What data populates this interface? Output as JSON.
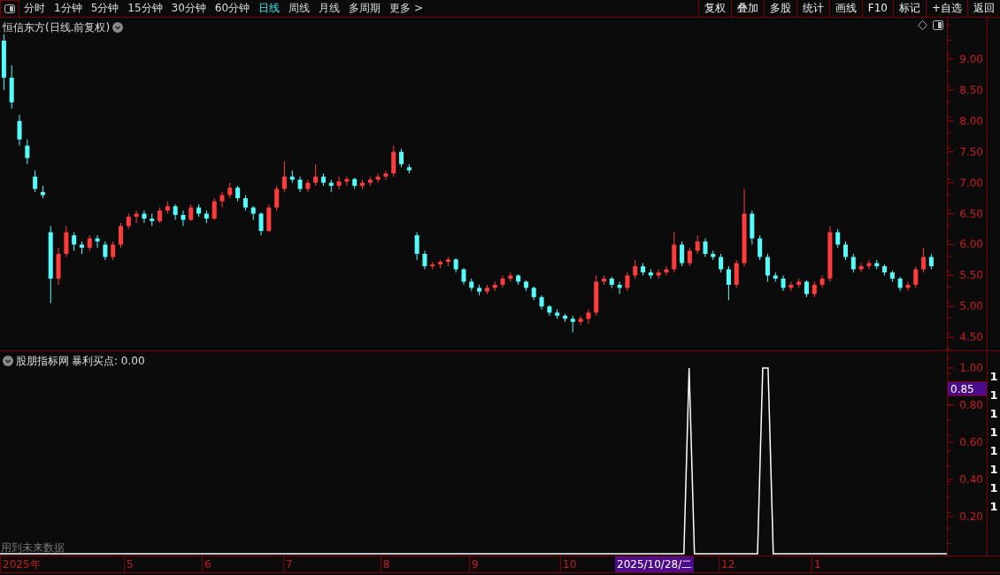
{
  "toolbar": {
    "periods": [
      {
        "label": "分时",
        "selected": false
      },
      {
        "label": "1分钟",
        "selected": false
      },
      {
        "label": "5分钟",
        "selected": false
      },
      {
        "label": "15分钟",
        "selected": false
      },
      {
        "label": "30分钟",
        "selected": false
      },
      {
        "label": "60分钟",
        "selected": false
      },
      {
        "label": "日线",
        "selected": true
      },
      {
        "label": "周线",
        "selected": false
      },
      {
        "label": "月线",
        "selected": false
      },
      {
        "label": "多周期",
        "selected": false
      },
      {
        "label": "更多 >",
        "selected": false
      }
    ],
    "buttons": [
      "复权",
      "叠加",
      "多股",
      "统计",
      "画线",
      "F10",
      "标记",
      "+自选",
      "返回"
    ]
  },
  "price_chart": {
    "chart_data": {
      "type": "candlestick",
      "title": "恒信东方(日线.前复权)",
      "ylim": [
        4.29,
        9.67
      ],
      "yticks": [
        {
          "value": 9,
          "label": "9.00"
        },
        {
          "value": 8.5,
          "label": "8.50"
        },
        {
          "value": 8,
          "label": "8.00"
        },
        {
          "value": 7.5,
          "label": "7.50"
        },
        {
          "value": 7,
          "label": "7.00"
        },
        {
          "value": 6.5,
          "label": "6.50"
        },
        {
          "value": 6,
          "label": "6.00"
        },
        {
          "value": 5.5,
          "label": "5.50"
        },
        {
          "value": 5,
          "label": "5.00"
        },
        {
          "value": 4.5,
          "label": "4.50"
        }
      ],
      "categories": [
        null,
        null,
        null,
        null,
        null,
        null,
        null,
        null,
        null,
        null,
        null,
        null,
        null,
        null,
        null,
        null,
        null,
        null,
        null,
        null,
        null,
        null,
        null,
        null,
        null,
        null,
        null,
        null,
        null,
        null,
        null,
        null,
        null,
        null,
        null,
        null,
        null,
        null,
        null,
        null,
        null,
        null,
        null,
        null,
        null,
        null,
        null,
        null,
        null,
        null,
        null,
        null,
        null,
        null,
        null,
        null,
        null,
        null,
        null,
        null,
        null,
        null,
        null,
        null,
        null,
        null,
        null,
        null,
        null,
        null,
        null,
        null,
        null,
        null,
        null,
        null,
        null,
        null,
        null,
        null,
        null,
        null,
        null,
        null,
        null,
        null,
        null,
        null,
        null,
        null,
        null,
        null,
        null,
        null,
        null,
        null,
        null,
        null,
        null,
        null,
        null,
        null,
        null,
        null,
        null,
        null,
        null,
        null,
        null,
        null,
        null,
        null,
        null,
        null,
        null,
        null,
        null,
        null,
        null,
        null
      ],
      "ohlc": [
        [
          9.3,
          9.4,
          8.5,
          8.7
        ],
        [
          8.7,
          8.9,
          8.2,
          8.3
        ],
        [
          8.0,
          8.1,
          7.6,
          7.7
        ],
        [
          7.6,
          7.7,
          7.3,
          7.4
        ],
        [
          7.1,
          7.2,
          6.85,
          6.9
        ],
        [
          6.85,
          6.95,
          6.75,
          6.8
        ],
        [
          6.2,
          6.3,
          5.05,
          5.45
        ],
        [
          5.45,
          5.95,
          5.35,
          5.85
        ],
        [
          5.85,
          6.3,
          5.8,
          6.2
        ],
        [
          6.15,
          6.2,
          5.9,
          6.0
        ],
        [
          6.0,
          6.05,
          5.85,
          5.95
        ],
        [
          5.95,
          6.15,
          5.9,
          6.1
        ],
        [
          6.1,
          6.15,
          5.95,
          6.05
        ],
        [
          6.0,
          6.05,
          5.75,
          5.8
        ],
        [
          5.8,
          6.05,
          5.75,
          6.0
        ],
        [
          6.0,
          6.35,
          5.95,
          6.3
        ],
        [
          6.3,
          6.5,
          6.25,
          6.45
        ],
        [
          6.45,
          6.55,
          6.35,
          6.5
        ],
        [
          6.5,
          6.55,
          6.35,
          6.42
        ],
        [
          6.42,
          6.5,
          6.3,
          6.38
        ],
        [
          6.38,
          6.6,
          6.35,
          6.55
        ],
        [
          6.55,
          6.7,
          6.5,
          6.62
        ],
        [
          6.62,
          6.65,
          6.4,
          6.48
        ],
        [
          6.48,
          6.55,
          6.3,
          6.4
        ],
        [
          6.4,
          6.65,
          6.38,
          6.6
        ],
        [
          6.6,
          6.65,
          6.45,
          6.5
        ],
        [
          6.5,
          6.55,
          6.35,
          6.42
        ],
        [
          6.42,
          6.75,
          6.4,
          6.7
        ],
        [
          6.7,
          6.85,
          6.6,
          6.8
        ],
        [
          6.8,
          7.0,
          6.75,
          6.92
        ],
        [
          6.92,
          6.95,
          6.7,
          6.75
        ],
        [
          6.75,
          6.8,
          6.55,
          6.6
        ],
        [
          6.6,
          6.62,
          6.4,
          6.5
        ],
        [
          6.5,
          6.52,
          6.15,
          6.22
        ],
        [
          6.22,
          6.65,
          6.2,
          6.6
        ],
        [
          6.6,
          6.95,
          6.55,
          6.9
        ],
        [
          6.9,
          7.35,
          6.85,
          7.1
        ],
        [
          7.1,
          7.2,
          7.0,
          7.05
        ],
        [
          7.05,
          7.1,
          6.85,
          6.9
        ],
        [
          6.9,
          7.05,
          6.85,
          7.0
        ],
        [
          7.0,
          7.3,
          6.95,
          7.1
        ],
        [
          7.1,
          7.15,
          6.95,
          7.0
        ],
        [
          7.0,
          7.05,
          6.85,
          6.95
        ],
        [
          6.95,
          7.1,
          6.9,
          7.02
        ],
        [
          7.02,
          7.1,
          6.95,
          7.06
        ],
        [
          7.06,
          7.08,
          6.9,
          6.95
        ],
        [
          6.95,
          7.05,
          6.9,
          7.0
        ],
        [
          7.0,
          7.1,
          6.95,
          7.05
        ],
        [
          7.05,
          7.15,
          7.0,
          7.1
        ],
        [
          7.1,
          7.2,
          7.05,
          7.15
        ],
        [
          7.15,
          7.6,
          7.1,
          7.5
        ],
        [
          7.5,
          7.55,
          7.25,
          7.3
        ],
        [
          7.25,
          7.3,
          7.15,
          7.2
        ],
        [
          6.15,
          6.2,
          5.75,
          5.85
        ],
        [
          5.85,
          5.9,
          5.6,
          5.65
        ],
        [
          5.65,
          5.72,
          5.6,
          5.68
        ],
        [
          5.68,
          5.75,
          5.62,
          5.72
        ],
        [
          5.72,
          5.8,
          5.65,
          5.76
        ],
        [
          5.76,
          5.78,
          5.55,
          5.6
        ],
        [
          5.6,
          5.62,
          5.35,
          5.4
        ],
        [
          5.4,
          5.45,
          5.25,
          5.3
        ],
        [
          5.3,
          5.35,
          5.18,
          5.24
        ],
        [
          5.24,
          5.35,
          5.2,
          5.3
        ],
        [
          5.3,
          5.4,
          5.25,
          5.35
        ],
        [
          5.35,
          5.5,
          5.3,
          5.45
        ],
        [
          5.45,
          5.55,
          5.4,
          5.5
        ],
        [
          5.5,
          5.52,
          5.35,
          5.4
        ],
        [
          5.4,
          5.42,
          5.25,
          5.3
        ],
        [
          5.3,
          5.32,
          5.1,
          5.15
        ],
        [
          5.15,
          5.18,
          4.95,
          5.0
        ],
        [
          5.0,
          5.02,
          4.85,
          4.9
        ],
        [
          4.9,
          4.95,
          4.8,
          4.85
        ],
        [
          4.85,
          4.88,
          4.75,
          4.8
        ],
        [
          4.8,
          4.85,
          4.58,
          4.75
        ],
        [
          4.75,
          4.85,
          4.7,
          4.8
        ],
        [
          4.8,
          4.95,
          4.72,
          4.9
        ],
        [
          4.9,
          5.5,
          4.85,
          5.4
        ],
        [
          5.4,
          5.5,
          5.35,
          5.45
        ],
        [
          5.45,
          5.48,
          5.3,
          5.35
        ],
        [
          5.35,
          5.4,
          5.2,
          5.3
        ],
        [
          5.3,
          5.55,
          5.25,
          5.5
        ],
        [
          5.5,
          5.75,
          5.45,
          5.65
        ],
        [
          5.65,
          5.7,
          5.5,
          5.55
        ],
        [
          5.55,
          5.6,
          5.45,
          5.5
        ],
        [
          5.5,
          5.6,
          5.45,
          5.55
        ],
        [
          5.55,
          5.65,
          5.5,
          5.6
        ],
        [
          5.6,
          6.2,
          5.55,
          6.0
        ],
        [
          6.0,
          6.05,
          5.65,
          5.7
        ],
        [
          5.7,
          5.95,
          5.65,
          5.9
        ],
        [
          5.9,
          6.15,
          5.85,
          6.05
        ],
        [
          6.05,
          6.1,
          5.8,
          5.85
        ],
        [
          5.85,
          5.9,
          5.75,
          5.8
        ],
        [
          5.8,
          5.85,
          5.55,
          5.6
        ],
        [
          5.6,
          5.65,
          5.1,
          5.35
        ],
        [
          5.35,
          5.75,
          5.3,
          5.7
        ],
        [
          5.7,
          6.9,
          5.65,
          6.5
        ],
        [
          6.5,
          6.55,
          6.0,
          6.1
        ],
        [
          6.1,
          6.15,
          5.75,
          5.8
        ],
        [
          5.8,
          5.85,
          5.4,
          5.5
        ],
        [
          5.5,
          5.55,
          5.4,
          5.45
        ],
        [
          5.45,
          5.5,
          5.25,
          5.3
        ],
        [
          5.3,
          5.4,
          5.25,
          5.35
        ],
        [
          5.35,
          5.45,
          5.3,
          5.4
        ],
        [
          5.4,
          5.42,
          5.15,
          5.2
        ],
        [
          5.2,
          5.4,
          5.15,
          5.35
        ],
        [
          5.35,
          5.5,
          5.3,
          5.45
        ],
        [
          5.45,
          6.3,
          5.4,
          6.2
        ],
        [
          6.2,
          6.25,
          5.95,
          6.0
        ],
        [
          6.0,
          6.05,
          5.75,
          5.8
        ],
        [
          5.8,
          5.85,
          5.55,
          5.6
        ],
        [
          5.6,
          5.7,
          5.55,
          5.65
        ],
        [
          5.65,
          5.75,
          5.6,
          5.7
        ],
        [
          5.7,
          5.75,
          5.6,
          5.65
        ],
        [
          5.65,
          5.68,
          5.5,
          5.55
        ],
        [
          5.55,
          5.58,
          5.4,
          5.45
        ],
        [
          5.45,
          5.48,
          5.25,
          5.3
        ],
        [
          5.3,
          5.4,
          5.25,
          5.35
        ],
        [
          5.35,
          5.65,
          5.3,
          5.6
        ],
        [
          5.6,
          5.95,
          5.55,
          5.8
        ],
        [
          5.8,
          5.85,
          5.6,
          5.65
        ]
      ]
    }
  },
  "indicator": {
    "title": "股朋指标网",
    "readout": ": 0.00",
    "cursor_value": "0.85",
    "note": "用到未来数据",
    "chart_data": {
      "type": "line",
      "ylim": [
        0,
        1.09
      ],
      "categories": [
        null,
        null,
        null,
        null,
        null,
        null,
        null,
        null,
        null,
        null,
        null,
        null,
        null,
        null,
        null,
        null,
        null,
        null,
        null,
        null,
        null,
        null,
        null,
        null,
        null,
        null,
        null,
        null,
        null,
        null,
        null,
        null,
        null,
        null,
        null,
        null,
        null,
        null,
        null,
        null,
        null,
        null,
        null,
        null,
        null,
        null,
        null,
        null,
        null,
        null,
        null,
        null,
        null,
        null,
        null,
        null,
        null,
        null,
        null,
        null,
        null,
        null,
        null,
        null,
        null,
        null,
        null,
        null,
        null,
        null,
        null,
        null,
        null,
        null,
        null,
        null,
        null,
        null,
        null,
        null,
        null,
        null,
        null,
        null,
        null,
        null,
        null,
        null,
        null,
        null,
        null,
        null,
        null,
        null,
        null,
        null,
        null,
        null,
        null,
        null,
        null,
        null,
        null,
        null,
        null,
        null,
        null,
        null,
        null,
        null,
        null,
        null,
        null,
        null,
        null,
        null,
        null,
        null,
        null,
        null,
        null,
        null,
        null,
        null,
        null,
        null,
        null,
        null,
        null,
        null,
        null,
        null,
        null,
        null,
        null,
        null,
        null,
        null,
        null,
        null,
        null,
        null,
        null,
        null,
        null,
        null,
        null,
        null,
        null,
        null,
        null,
        null,
        null,
        null,
        null,
        null,
        null,
        null,
        null,
        null,
        null,
        null,
        null,
        null,
        null,
        null,
        null,
        null,
        null,
        null,
        null,
        null,
        null,
        null,
        null,
        null,
        null,
        null,
        null,
        null,
        null
      ],
      "yticks": [
        {
          "value": 1,
          "label": "1.00"
        },
        {
          "value": 0.8,
          "label": "0.80"
        },
        {
          "value": 0.6,
          "label": "0.60"
        },
        {
          "value": 0.4,
          "label": "0.40"
        },
        {
          "value": 0.2,
          "label": "0.20"
        }
      ],
      "series": [
        {
          "name": "暴利买点",
          "color": "#ffffff",
          "values": [
            0,
            0,
            0,
            0,
            0,
            0,
            0,
            0,
            0,
            0,
            0,
            0,
            0,
            0,
            0,
            0,
            0,
            0,
            0,
            0,
            0,
            0,
            0,
            0,
            0,
            0,
            0,
            0,
            0,
            0,
            0,
            0,
            0,
            0,
            0,
            0,
            0,
            0,
            0,
            0,
            0,
            0,
            0,
            0,
            0,
            0,
            0,
            0,
            0,
            0,
            0,
            0,
            0,
            0,
            0,
            0,
            0,
            0,
            0,
            0,
            0,
            0,
            0,
            0,
            0,
            0,
            0,
            0,
            0,
            0,
            0,
            0,
            0,
            0,
            0,
            0,
            0,
            0,
            0,
            0,
            0,
            0,
            0,
            0,
            0,
            0,
            0,
            0,
            0,
            0,
            0,
            0,
            0,
            0,
            0,
            0,
            0,
            0,
            0,
            0,
            0,
            0,
            0,
            0,
            0,
            0,
            0,
            0,
            0,
            0,
            0,
            0,
            0,
            0,
            0,
            0,
            0,
            0,
            0,
            0,
            0,
            0,
            0,
            0,
            0,
            0,
            0,
            0,
            0,
            0,
            0,
            1,
            0,
            0,
            0,
            0,
            0,
            0,
            0,
            0,
            0,
            0,
            0,
            0,
            0,
            1,
            1,
            0,
            0,
            0,
            0,
            0,
            0,
            0,
            0,
            0,
            0,
            0,
            0,
            0,
            0,
            0,
            0,
            0,
            0,
            0,
            0,
            0,
            0,
            0,
            0,
            0,
            0,
            0,
            0,
            0,
            0,
            0,
            0,
            0,
            0
          ]
        }
      ]
    }
  },
  "side_strip": {
    "digits": [
      "1",
      "1",
      "1",
      "1",
      "1",
      "1",
      "1",
      "1"
    ]
  },
  "date_axis": {
    "labels": [
      "2025年",
      "5",
      "6",
      "7",
      "8",
      "9",
      "10",
      "12",
      "1"
    ],
    "cursor_date": "2025/10/28/二"
  }
}
